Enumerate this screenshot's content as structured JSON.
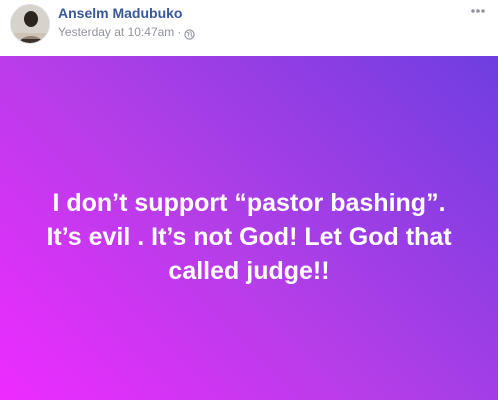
{
  "post": {
    "author": "Anselm Madubuko",
    "timestamp": "Yesterday at 10:47am",
    "separator": "·",
    "privacy_icon": "globe-icon",
    "more_icon": "more-options-icon",
    "text": "I don’t support “pastor bashing”. It’s evil . It’s not God! Let God that called judge!!"
  },
  "colors": {
    "author_link": "#385898",
    "meta_text": "#90949c",
    "gradient_start": "#ee2bff",
    "gradient_end": "#6e3ee0",
    "post_text": "#ffffff"
  }
}
